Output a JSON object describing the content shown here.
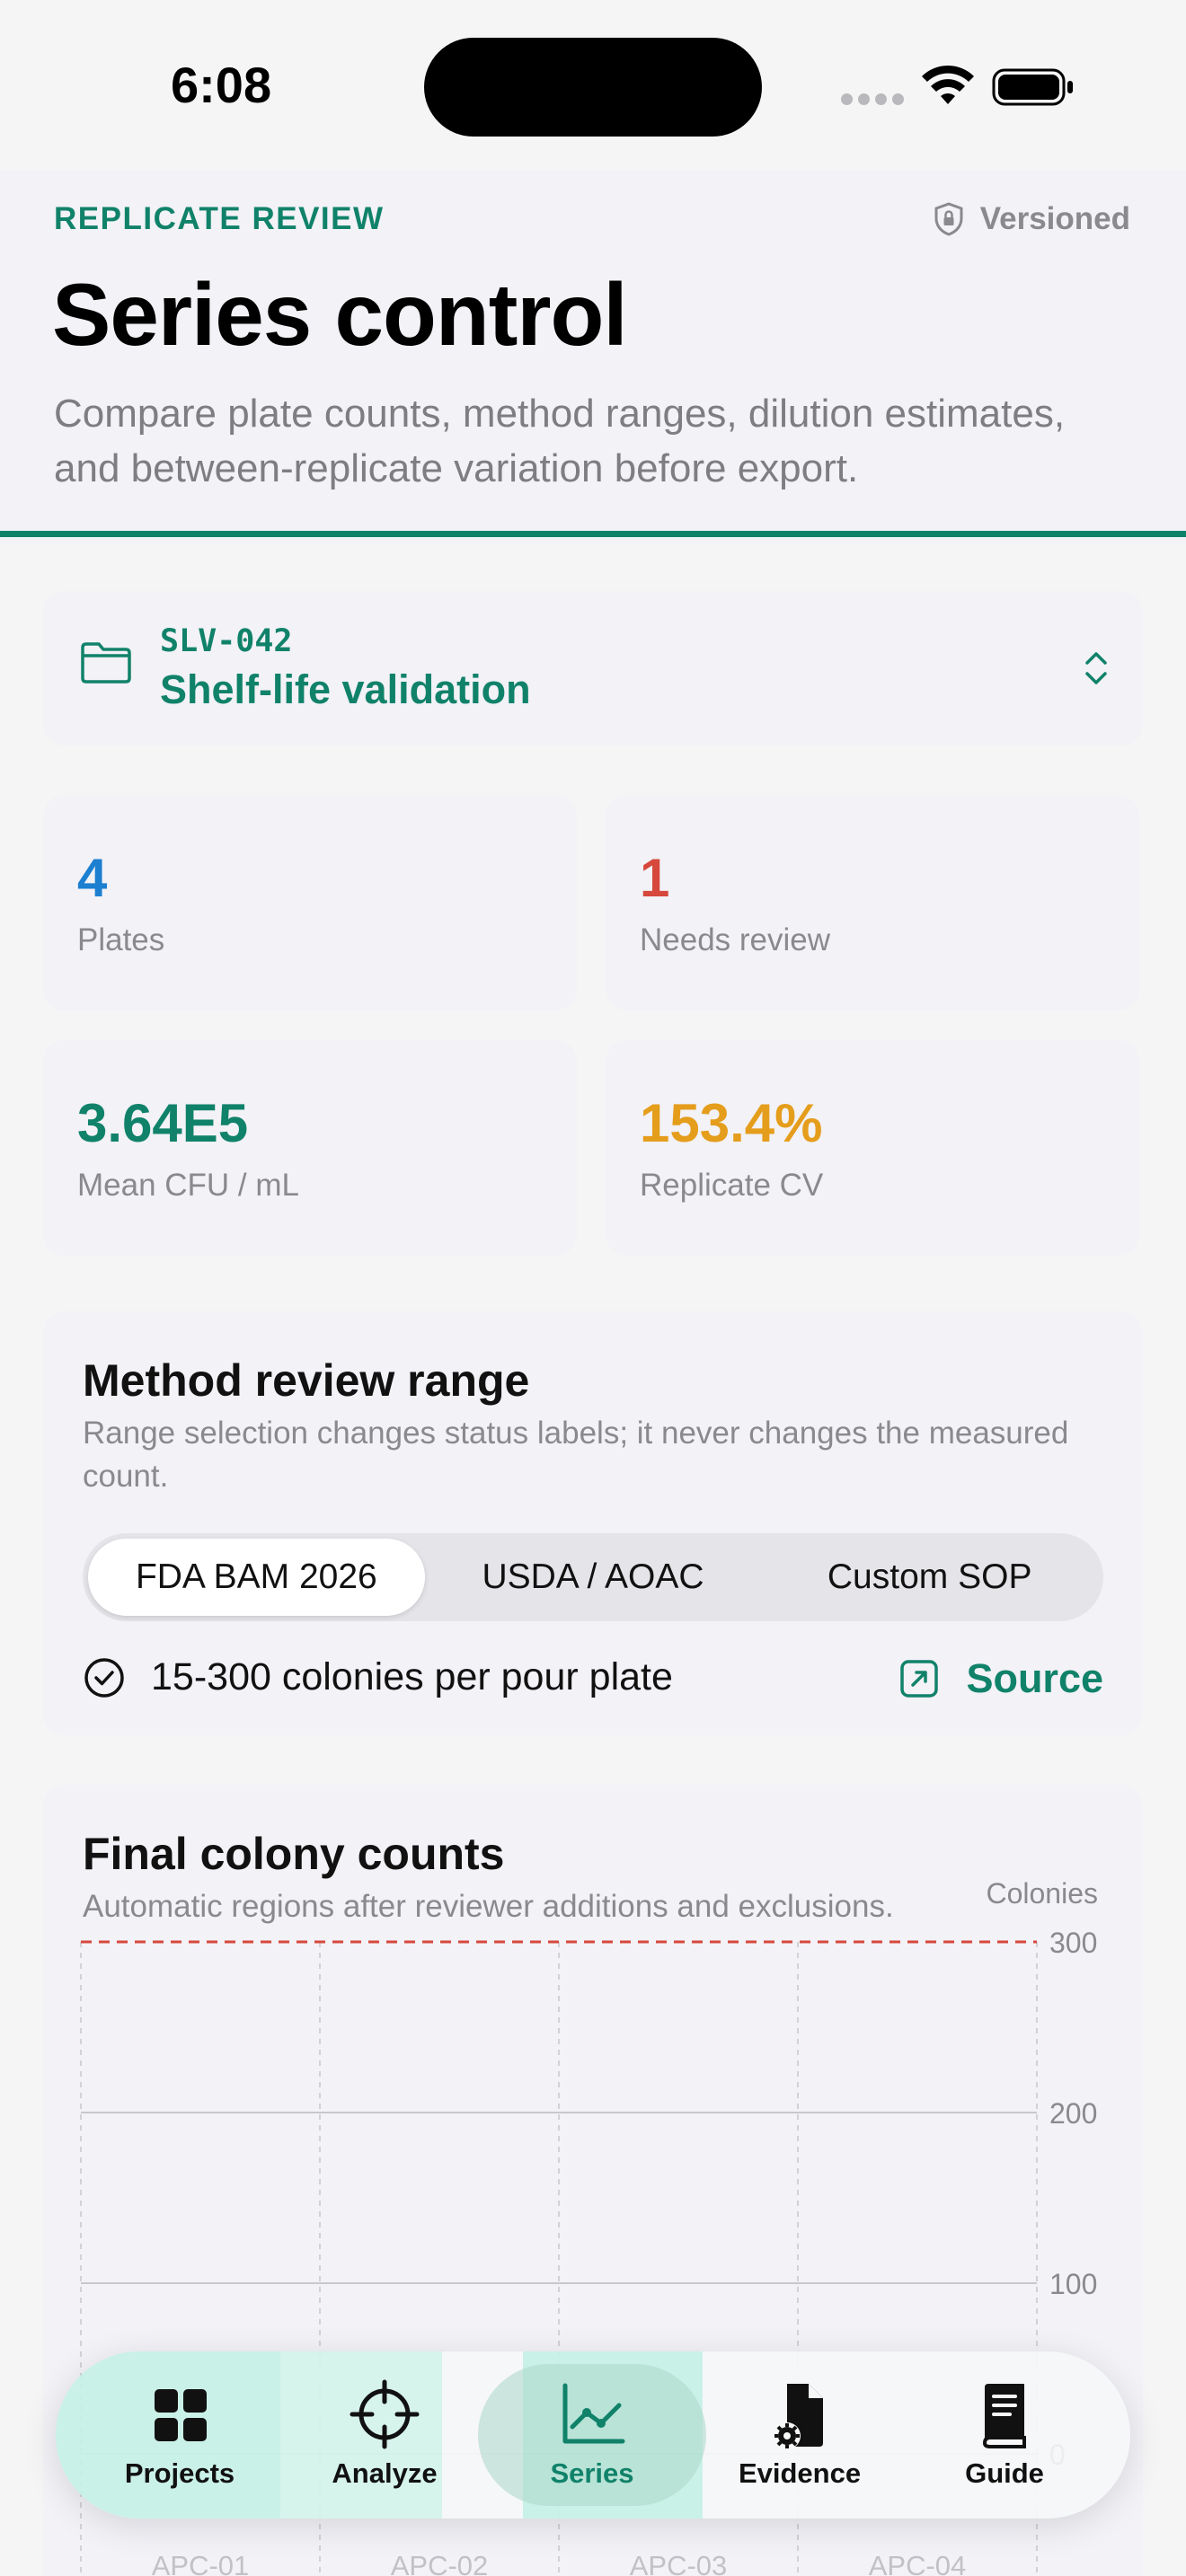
{
  "status": {
    "time": "6:08"
  },
  "header": {
    "eyebrow": "REPLICATE REVIEW",
    "badge": "Versioned",
    "title": "Series control",
    "subtitle": "Compare plate counts, method ranges, dilution estimates, and between-replicate variation before export."
  },
  "project": {
    "code": "SLV-042",
    "name": "Shelf-life validation",
    "icon": "folder-icon"
  },
  "stats": [
    {
      "value": "4",
      "label": "Plates",
      "color": "#1d7fd0"
    },
    {
      "value": "1",
      "label": "Needs review",
      "color": "#d6483c"
    },
    {
      "value": "3.64E5",
      "label": "Mean CFU / mL",
      "color": "#11826a"
    },
    {
      "value": "153.4%",
      "label": "Replicate CV",
      "color": "#e59d1c"
    }
  ],
  "method": {
    "title": "Method review range",
    "subtitle": "Range selection changes status labels; it never changes the measured count.",
    "options": [
      "FDA BAM 2026",
      "USDA / AOAC",
      "Custom SOP"
    ],
    "selected": "FDA BAM 2026",
    "range_text": "15-300 colonies per pour plate",
    "source_label": "Source"
  },
  "chart": {
    "title": "Final colony counts",
    "subtitle": "Automatic regions after reviewer additions and exclusions."
  },
  "chart_data": {
    "type": "bar",
    "ylabel": "Colonies",
    "ylim": [
      0,
      300
    ],
    "yticks": [
      "300",
      "200",
      "100",
      "0"
    ],
    "categories": [
      "APC-01",
      "APC-02",
      "APC-03",
      "APC-04"
    ],
    "threshold": 300,
    "threshold_color": "#d6483c",
    "bar_colors": [
      "#3fd6ae",
      "#3fd6ae",
      "#3fd6ae",
      "#e8b860"
    ]
  },
  "tabs": [
    {
      "label": "Projects",
      "icon": "grid-icon"
    },
    {
      "label": "Analyze",
      "icon": "crosshair-icon"
    },
    {
      "label": "Series",
      "icon": "line-chart-icon",
      "active": true
    },
    {
      "label": "Evidence",
      "icon": "document-gear-icon"
    },
    {
      "label": "Guide",
      "icon": "book-icon"
    }
  ],
  "accent": "#11826a"
}
